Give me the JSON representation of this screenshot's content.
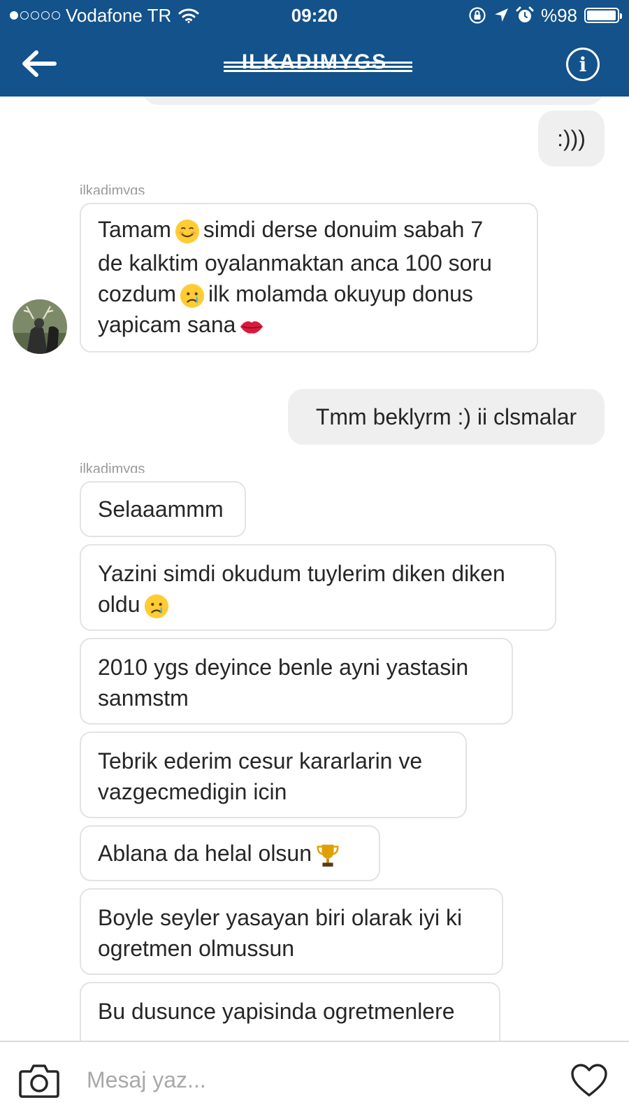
{
  "status_bar": {
    "carrier": "Vodafone TR",
    "time": "09:20",
    "battery_text": "%98",
    "battery_level": 0.98,
    "signal_bars_filled": 1,
    "signal_bars_total": 5
  },
  "nav": {
    "title": "ILKADIMYGS"
  },
  "messages": {
    "m0_text": ":)))",
    "sender_1": "ilkadimygs",
    "m1_line1_a": "Tamam",
    "m1_line1_b": "simdi derse donuim sabah 7",
    "m1_line2": "de kalktim oyalanmaktan anca 100 soru",
    "m1_line3_a": "cozdum",
    "m1_line3_b": "ilk molamda okuyup donus",
    "m1_line4": "yapicam sana",
    "m2_text": "Tmm beklyrm :) ii clsmalar",
    "sender_2": "ilkadimygs",
    "m3_text": "Selaaammm",
    "m4_line1": "Yazini simdi okudum tuylerim diken diken",
    "m4_line2": "oldu",
    "m5_line1": "2010 ygs deyince benle ayni yastasin",
    "m5_line2": "sanmstm",
    "m6_line1": "Tebrik ederim cesur kararlarin ve",
    "m6_line2": "vazgecmedigin icin",
    "m7_text": "Ablana da helal olsun",
    "m8_line1": "Boyle seyler yasayan biri olarak iyi ki",
    "m8_line2": "ogretmen olmussun",
    "m9_line1": "Bu dusunce yapisinda ogretmenlere"
  },
  "composer": {
    "placeholder": "Mesaj yaz..."
  },
  "icons": {
    "back": "arrow-left-icon",
    "info": "info-icon",
    "camera": "camera-icon",
    "heart": "heart-icon",
    "emoji_smile": "smiling-face-icon",
    "emoji_cry": "crying-face-icon",
    "emoji_kiss": "kiss-mark-icon",
    "emoji_trophy": "trophy-icon"
  },
  "colors": {
    "header_bg": "#13528a",
    "outgoing_bubble": "#efefef",
    "incoming_border": "#e3e3e3"
  }
}
